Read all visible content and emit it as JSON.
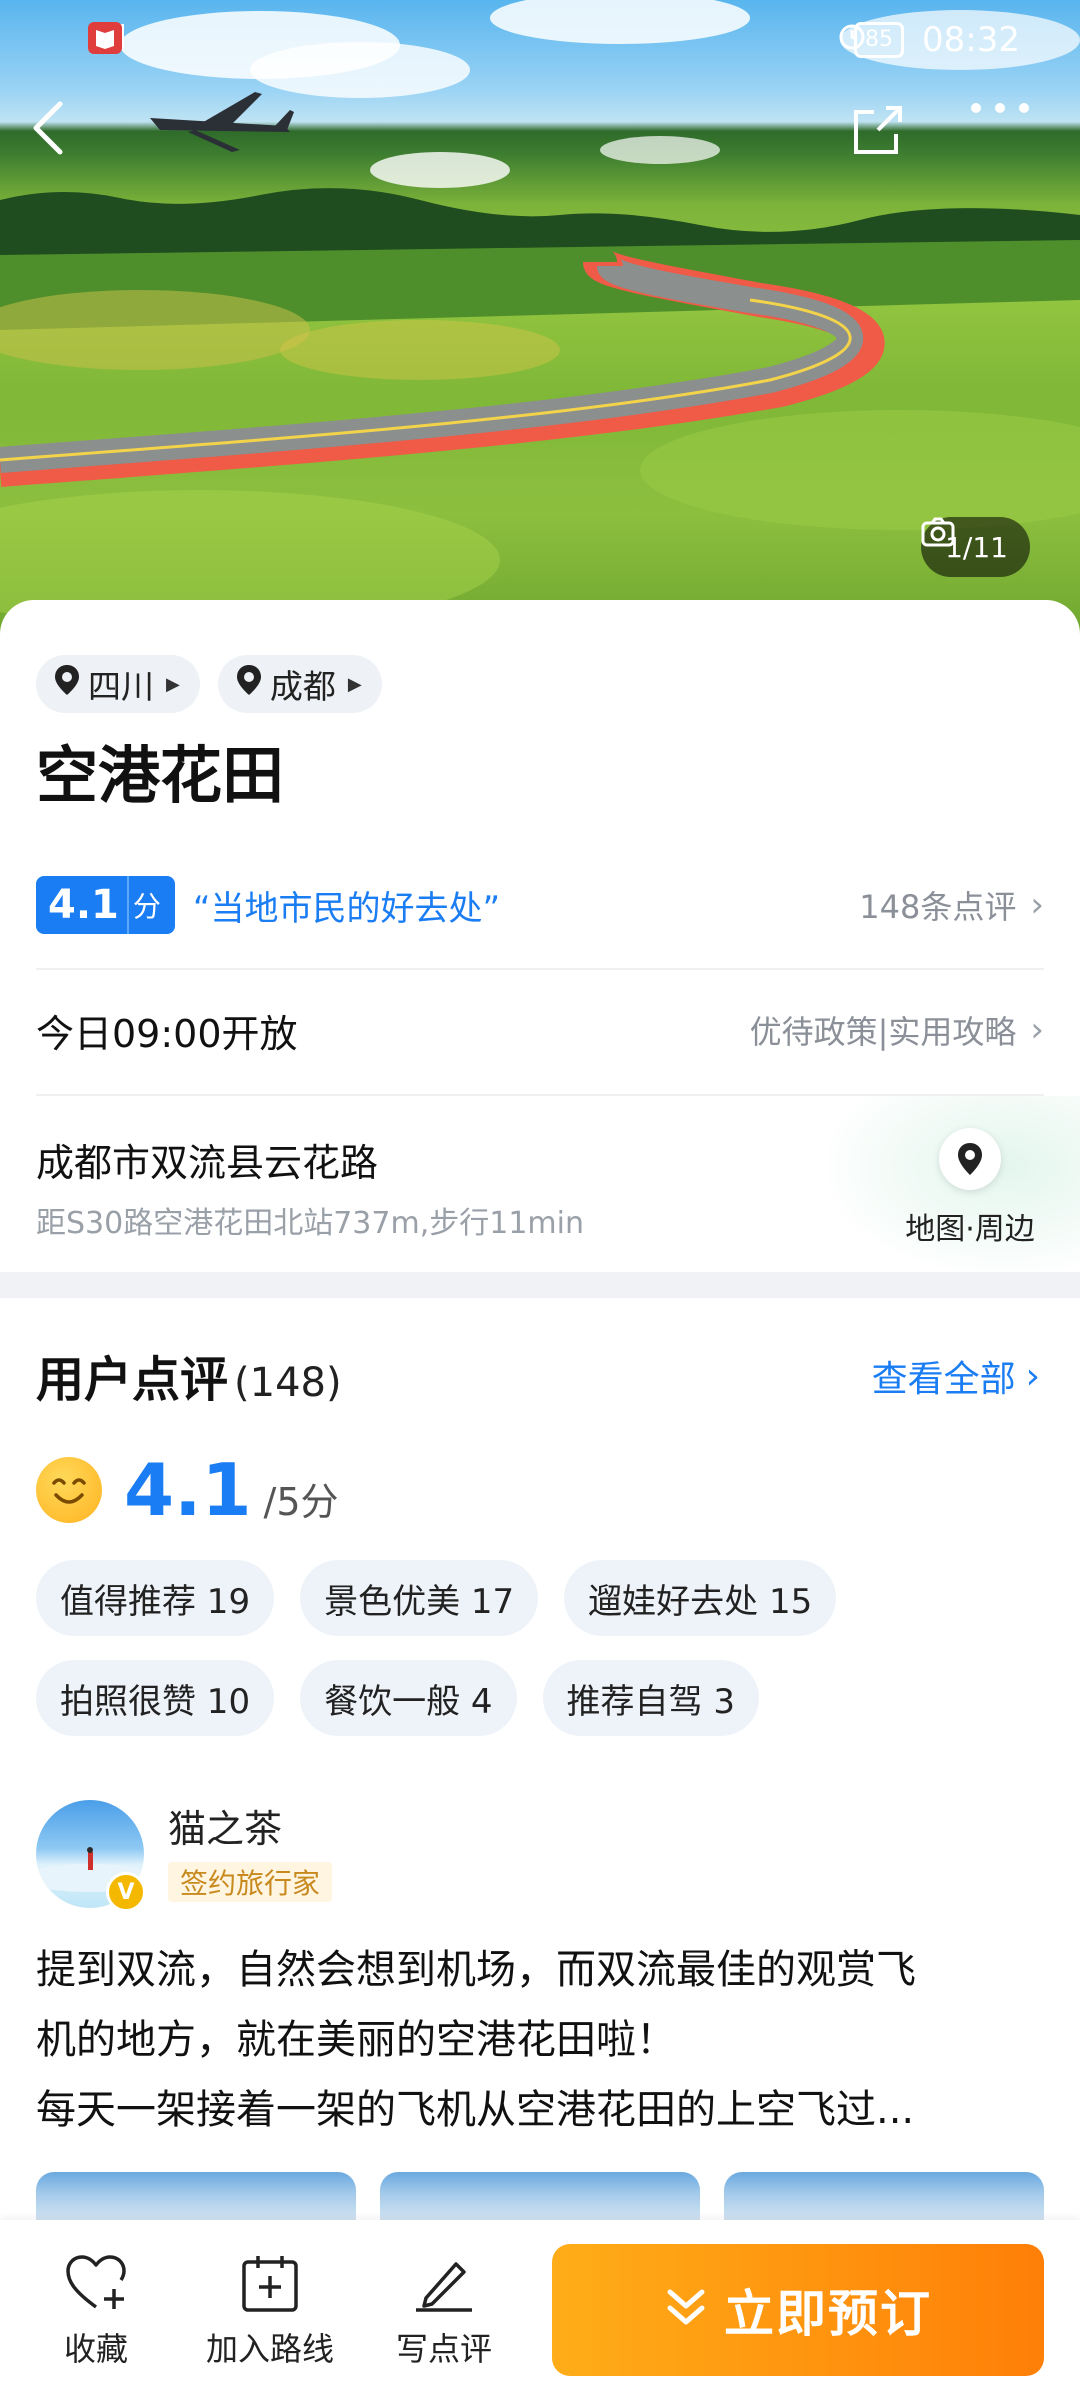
{
  "status_bar": {
    "time": "08:32",
    "battery": "85"
  },
  "hero": {
    "photo_counter": "1/11"
  },
  "location_chips": [
    {
      "label": "四川"
    },
    {
      "label": "成都"
    }
  ],
  "poi": {
    "title": "空港花田",
    "rating": "4.1",
    "rating_unit": "分",
    "tagline": "“当地市民的好去处”",
    "review_count_text": "148条点评",
    "open_hours": "今日09:00开放",
    "policy_link": "优待政策|实用攻略",
    "address": "成都市双流县云花路",
    "distance": "距S30路空港花田北站737m,步行11min",
    "map_link": "地图·周边"
  },
  "reviews": {
    "title": "用户点评",
    "count": "(148)",
    "see_all": "查看全部",
    "score": "4.1",
    "score_unit": "/5分",
    "tags": [
      "值得推荐 19",
      "景色优美 17",
      "遛娃好去处 15",
      "拍照很赞 10",
      "餐饮一般 4",
      "推荐自驾 3"
    ],
    "first": {
      "user": "猫之茶",
      "badge": "签约旅行家",
      "lines": [
        "提到双流，自然会想到机场，而双流最佳的观赏飞",
        "机的地方，就在美丽的空港花田啦！",
        "每天一架接着一架的飞机从空港花田的上空飞过..."
      ]
    }
  },
  "bottom_bar": {
    "favorite": "收藏",
    "add_route": "加入路线",
    "write_review": "写点评",
    "book_now": "立即预订"
  },
  "colors": {
    "accent": "#1a7df3",
    "book_start": "#ffad18",
    "book_end": "#ff7f07"
  }
}
